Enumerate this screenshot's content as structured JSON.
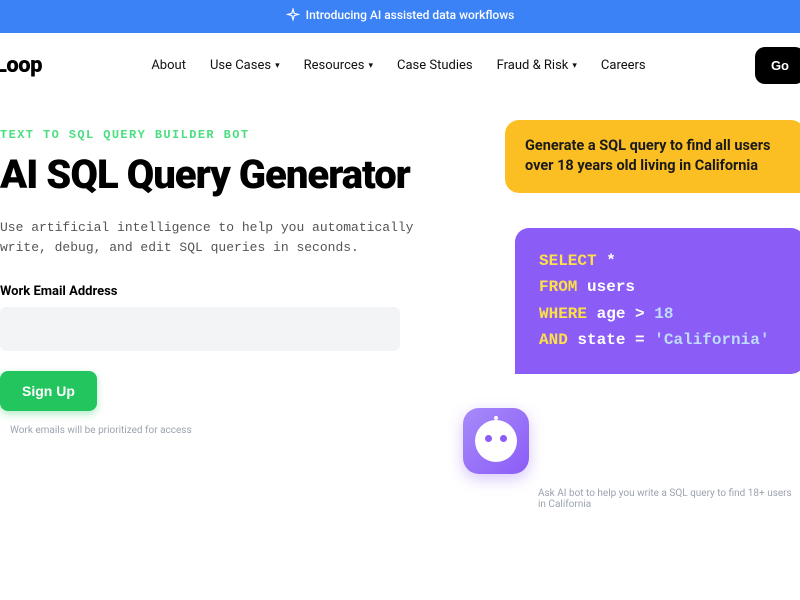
{
  "banner": {
    "text": "Introducing AI assisted data workflows"
  },
  "logo": "Loop",
  "nav": {
    "items": [
      {
        "label": "About",
        "dropdown": false
      },
      {
        "label": "Use Cases",
        "dropdown": true
      },
      {
        "label": "Resources",
        "dropdown": true
      },
      {
        "label": "Case Studies",
        "dropdown": false
      },
      {
        "label": "Fraud & Risk",
        "dropdown": true
      },
      {
        "label": "Careers",
        "dropdown": false
      }
    ],
    "cta": "Go"
  },
  "hero": {
    "eyebrow": "TEXT TO SQL QUERY BUILDER BOT",
    "title": "AI SQL Query Generator",
    "subtitle": "Use artificial intelligence to help you automatically write, debug, and edit SQL queries in seconds.",
    "email_label": "Work Email Address",
    "email_placeholder": "",
    "signup": "Sign Up",
    "hint": "Work emails will be prioritized for access"
  },
  "chat": {
    "user_msg": "Generate a SQL query to find all users over 18 years old living in California",
    "ai_code": {
      "l1_kw": "SELECT",
      "l1_rest": " *",
      "l2_kw": "FROM",
      "l2_rest": " users",
      "l3_kw": "WHERE",
      "l3_rest": " age > ",
      "l3_val": "18",
      "l4_kw": "AND",
      "l4_rest": " state = ",
      "l4_val": "'California'"
    },
    "caption": "Ask AI bot to help you write a SQL query to find 18+ users in California"
  }
}
